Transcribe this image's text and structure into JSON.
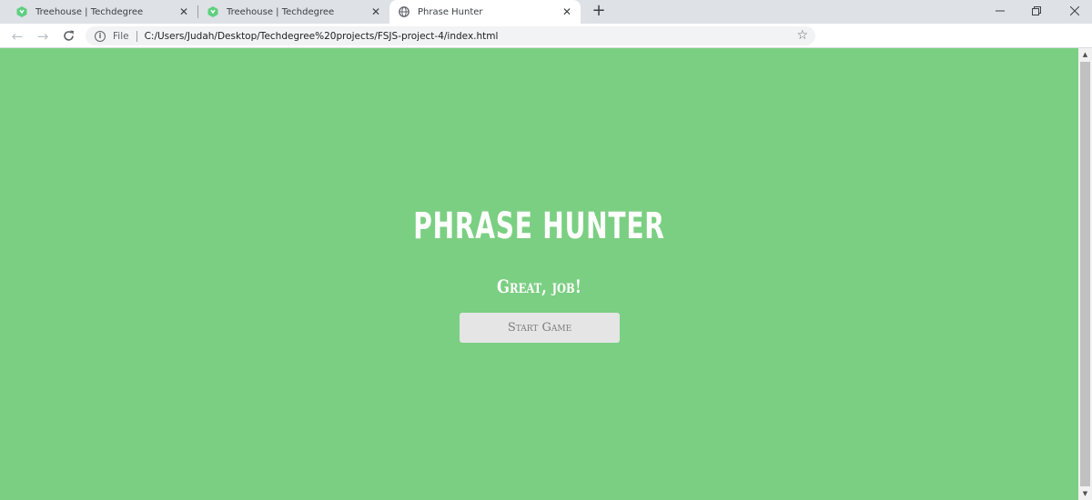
{
  "browser": {
    "tabs": [
      {
        "title": "Treehouse | Techdegree"
      },
      {
        "title": "Treehouse | Techdegree"
      },
      {
        "title": "Phrase Hunter"
      }
    ],
    "new_tab_label": "+",
    "address": {
      "scheme_label": "File",
      "url": "C:/Users/Judah/Desktop/Techdegree%20projects/FSJS-project-4/index.html"
    }
  },
  "page": {
    "title": "PHRASE HUNTER",
    "message": "Great, job!",
    "start_button": "Start Game",
    "background_color": "#7bcf82"
  },
  "icons": {
    "tab_favicon": "treehouse-icon",
    "active_favicon": "globe-icon",
    "back": "back-arrow-icon",
    "forward": "forward-arrow-icon",
    "reload": "reload-icon",
    "info": "info-icon",
    "bookmark": "star-icon"
  }
}
